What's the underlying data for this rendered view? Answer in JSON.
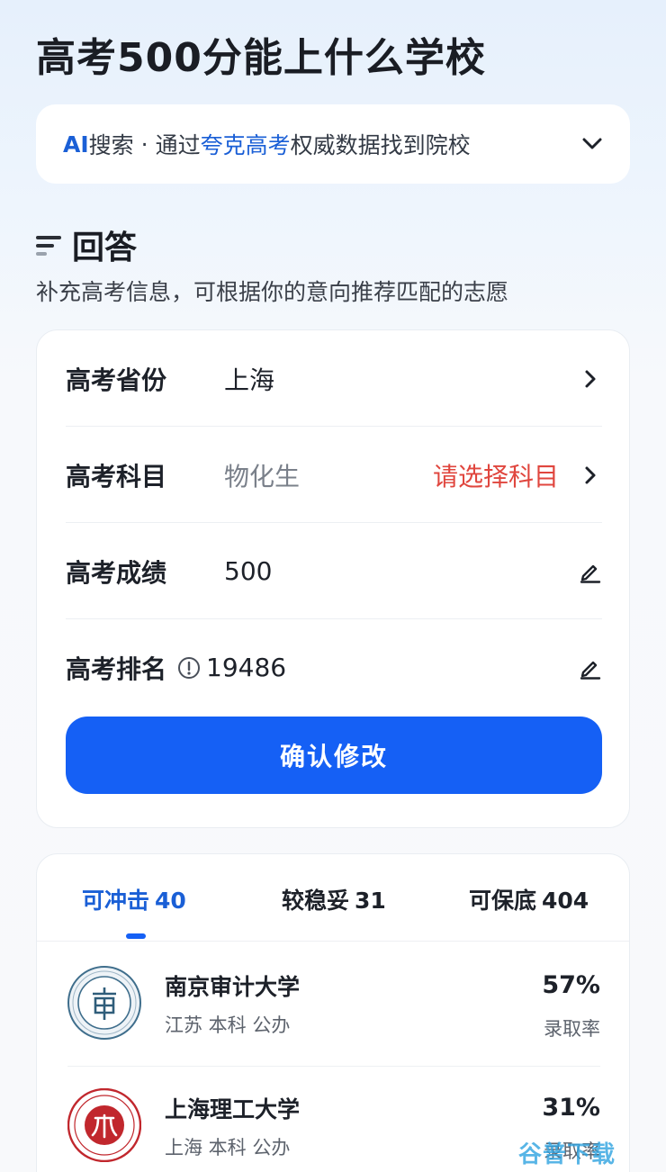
{
  "header": {
    "title": "高考500分能上什么学校"
  },
  "ai_search": {
    "prefix": "AI",
    "prefix_tail": "搜索",
    "separator": "·",
    "middle": "通过",
    "brand": "夸克高考",
    "suffix": "权威数据找到院校"
  },
  "answer": {
    "title": "回答",
    "subtitle": "补充高考信息，可根据你的意向推荐匹配的志愿"
  },
  "form": {
    "rows": [
      {
        "label": "高考省份",
        "value": "上海"
      },
      {
        "label": "高考科目",
        "value": "物化生",
        "hint": "请选择科目"
      },
      {
        "label": "高考成绩",
        "value": "500"
      },
      {
        "label": "高考排名",
        "value": "19486"
      }
    ],
    "confirm_label": "确认修改"
  },
  "tabs": [
    {
      "label": "可冲击",
      "count": "40",
      "active": true
    },
    {
      "label": "较稳妥",
      "count": "31",
      "active": false
    },
    {
      "label": "可保底",
      "count": "404",
      "active": false
    }
  ],
  "schools": [
    {
      "name": "南京审计大学",
      "meta": "江苏 本科 公办",
      "rate": "57%",
      "rate_label": "录取率"
    },
    {
      "name": "上海理工大学",
      "meta": "上海 本科 公办",
      "rate": "31%",
      "rate_label": "录取率"
    }
  ],
  "watermark": "谷普下载",
  "colors": {
    "accent": "#1560f5",
    "hint": "#e0463e",
    "brand_text": "#1a5fd6"
  }
}
